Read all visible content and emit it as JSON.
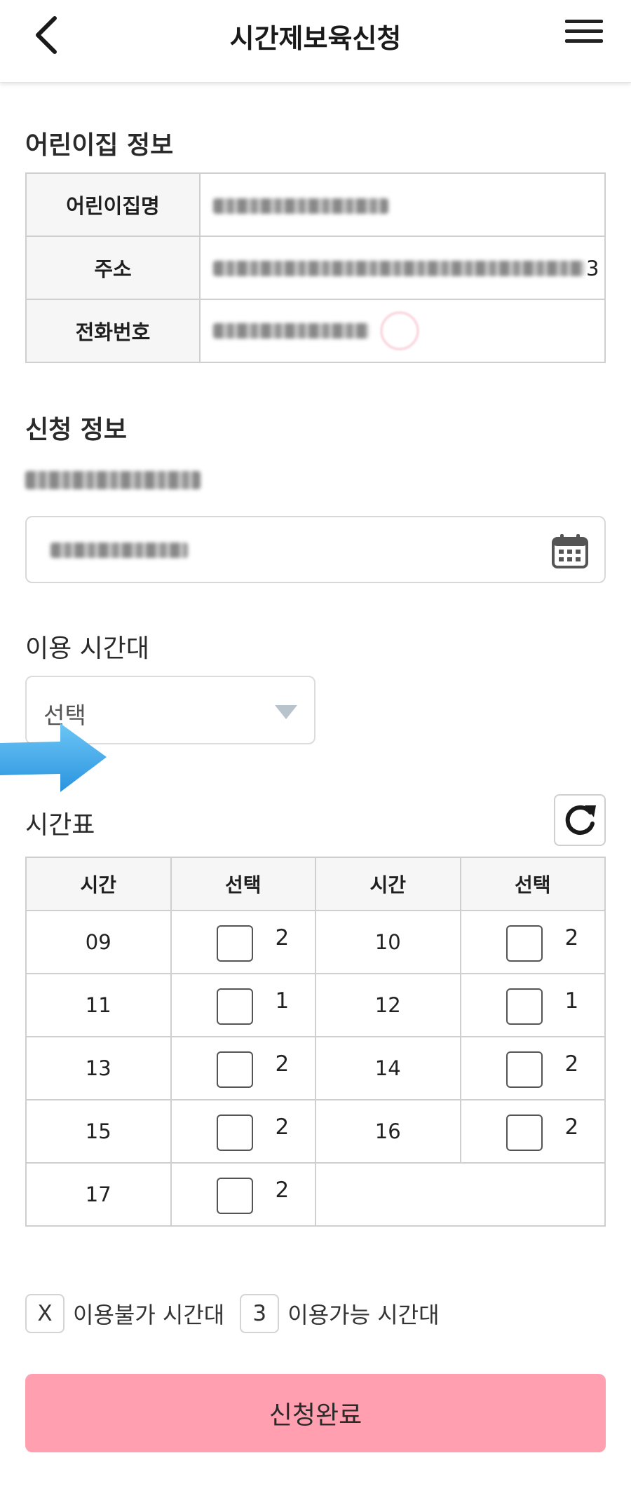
{
  "header": {
    "title": "시간제보육신청",
    "back_icon": "chevron-left-icon",
    "menu_icon": "hamburger-menu-icon"
  },
  "daycare_info": {
    "section_title": "어린이집 정보",
    "rows": [
      {
        "label": "어린이집명"
      },
      {
        "label": "주소",
        "value_suffix": "3"
      },
      {
        "label": "전화번호"
      }
    ]
  },
  "application_info": {
    "section_title": "신청 정보",
    "calendar_icon": "calendar-icon"
  },
  "time_slot": {
    "label": "이용 시간대",
    "select_value": "선택"
  },
  "timetable": {
    "label": "시간표",
    "refresh_icon": "refresh-icon",
    "headers": [
      "시간",
      "선택",
      "시간",
      "선택"
    ],
    "slots": [
      {
        "hour": "09",
        "count": "2"
      },
      {
        "hour": "10",
        "count": "2"
      },
      {
        "hour": "11",
        "count": "1"
      },
      {
        "hour": "12",
        "count": "1"
      },
      {
        "hour": "13",
        "count": "2"
      },
      {
        "hour": "14",
        "count": "2"
      },
      {
        "hour": "15",
        "count": "2"
      },
      {
        "hour": "16",
        "count": "2"
      },
      {
        "hour": "17",
        "count": "2"
      }
    ]
  },
  "legend": {
    "unavailable_symbol": "X",
    "unavailable_label": "이용불가 시간대",
    "available_symbol": "3",
    "available_label": "이용가능 시간대"
  },
  "submit": {
    "label": "신청완료"
  },
  "colors": {
    "submit_button": "#ff9faf",
    "pointer_arrow": "#3aa8ea"
  }
}
